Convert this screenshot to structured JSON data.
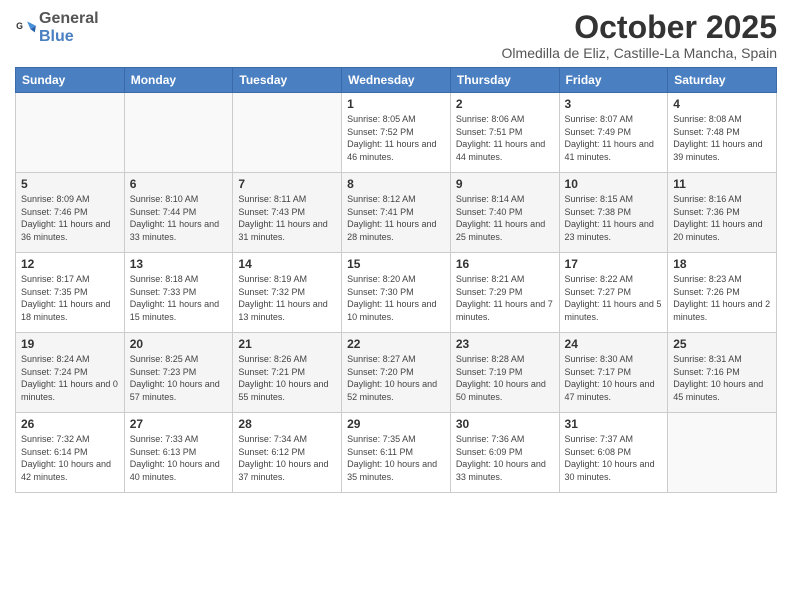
{
  "logo": {
    "general": "General",
    "blue": "Blue"
  },
  "header": {
    "month": "October 2025",
    "subtitle": "Olmedilla de Eliz, Castille-La Mancha, Spain"
  },
  "weekdays": [
    "Sunday",
    "Monday",
    "Tuesday",
    "Wednesday",
    "Thursday",
    "Friday",
    "Saturday"
  ],
  "weeks": [
    [
      {
        "day": "",
        "sunrise": "",
        "sunset": "",
        "daylight": ""
      },
      {
        "day": "",
        "sunrise": "",
        "sunset": "",
        "daylight": ""
      },
      {
        "day": "",
        "sunrise": "",
        "sunset": "",
        "daylight": ""
      },
      {
        "day": "1",
        "sunrise": "Sunrise: 8:05 AM",
        "sunset": "Sunset: 7:52 PM",
        "daylight": "Daylight: 11 hours and 46 minutes."
      },
      {
        "day": "2",
        "sunrise": "Sunrise: 8:06 AM",
        "sunset": "Sunset: 7:51 PM",
        "daylight": "Daylight: 11 hours and 44 minutes."
      },
      {
        "day": "3",
        "sunrise": "Sunrise: 8:07 AM",
        "sunset": "Sunset: 7:49 PM",
        "daylight": "Daylight: 11 hours and 41 minutes."
      },
      {
        "day": "4",
        "sunrise": "Sunrise: 8:08 AM",
        "sunset": "Sunset: 7:48 PM",
        "daylight": "Daylight: 11 hours and 39 minutes."
      }
    ],
    [
      {
        "day": "5",
        "sunrise": "Sunrise: 8:09 AM",
        "sunset": "Sunset: 7:46 PM",
        "daylight": "Daylight: 11 hours and 36 minutes."
      },
      {
        "day": "6",
        "sunrise": "Sunrise: 8:10 AM",
        "sunset": "Sunset: 7:44 PM",
        "daylight": "Daylight: 11 hours and 33 minutes."
      },
      {
        "day": "7",
        "sunrise": "Sunrise: 8:11 AM",
        "sunset": "Sunset: 7:43 PM",
        "daylight": "Daylight: 11 hours and 31 minutes."
      },
      {
        "day": "8",
        "sunrise": "Sunrise: 8:12 AM",
        "sunset": "Sunset: 7:41 PM",
        "daylight": "Daylight: 11 hours and 28 minutes."
      },
      {
        "day": "9",
        "sunrise": "Sunrise: 8:14 AM",
        "sunset": "Sunset: 7:40 PM",
        "daylight": "Daylight: 11 hours and 25 minutes."
      },
      {
        "day": "10",
        "sunrise": "Sunrise: 8:15 AM",
        "sunset": "Sunset: 7:38 PM",
        "daylight": "Daylight: 11 hours and 23 minutes."
      },
      {
        "day": "11",
        "sunrise": "Sunrise: 8:16 AM",
        "sunset": "Sunset: 7:36 PM",
        "daylight": "Daylight: 11 hours and 20 minutes."
      }
    ],
    [
      {
        "day": "12",
        "sunrise": "Sunrise: 8:17 AM",
        "sunset": "Sunset: 7:35 PM",
        "daylight": "Daylight: 11 hours and 18 minutes."
      },
      {
        "day": "13",
        "sunrise": "Sunrise: 8:18 AM",
        "sunset": "Sunset: 7:33 PM",
        "daylight": "Daylight: 11 hours and 15 minutes."
      },
      {
        "day": "14",
        "sunrise": "Sunrise: 8:19 AM",
        "sunset": "Sunset: 7:32 PM",
        "daylight": "Daylight: 11 hours and 13 minutes."
      },
      {
        "day": "15",
        "sunrise": "Sunrise: 8:20 AM",
        "sunset": "Sunset: 7:30 PM",
        "daylight": "Daylight: 11 hours and 10 minutes."
      },
      {
        "day": "16",
        "sunrise": "Sunrise: 8:21 AM",
        "sunset": "Sunset: 7:29 PM",
        "daylight": "Daylight: 11 hours and 7 minutes."
      },
      {
        "day": "17",
        "sunrise": "Sunrise: 8:22 AM",
        "sunset": "Sunset: 7:27 PM",
        "daylight": "Daylight: 11 hours and 5 minutes."
      },
      {
        "day": "18",
        "sunrise": "Sunrise: 8:23 AM",
        "sunset": "Sunset: 7:26 PM",
        "daylight": "Daylight: 11 hours and 2 minutes."
      }
    ],
    [
      {
        "day": "19",
        "sunrise": "Sunrise: 8:24 AM",
        "sunset": "Sunset: 7:24 PM",
        "daylight": "Daylight: 11 hours and 0 minutes."
      },
      {
        "day": "20",
        "sunrise": "Sunrise: 8:25 AM",
        "sunset": "Sunset: 7:23 PM",
        "daylight": "Daylight: 10 hours and 57 minutes."
      },
      {
        "day": "21",
        "sunrise": "Sunrise: 8:26 AM",
        "sunset": "Sunset: 7:21 PM",
        "daylight": "Daylight: 10 hours and 55 minutes."
      },
      {
        "day": "22",
        "sunrise": "Sunrise: 8:27 AM",
        "sunset": "Sunset: 7:20 PM",
        "daylight": "Daylight: 10 hours and 52 minutes."
      },
      {
        "day": "23",
        "sunrise": "Sunrise: 8:28 AM",
        "sunset": "Sunset: 7:19 PM",
        "daylight": "Daylight: 10 hours and 50 minutes."
      },
      {
        "day": "24",
        "sunrise": "Sunrise: 8:30 AM",
        "sunset": "Sunset: 7:17 PM",
        "daylight": "Daylight: 10 hours and 47 minutes."
      },
      {
        "day": "25",
        "sunrise": "Sunrise: 8:31 AM",
        "sunset": "Sunset: 7:16 PM",
        "daylight": "Daylight: 10 hours and 45 minutes."
      }
    ],
    [
      {
        "day": "26",
        "sunrise": "Sunrise: 7:32 AM",
        "sunset": "Sunset: 6:14 PM",
        "daylight": "Daylight: 10 hours and 42 minutes."
      },
      {
        "day": "27",
        "sunrise": "Sunrise: 7:33 AM",
        "sunset": "Sunset: 6:13 PM",
        "daylight": "Daylight: 10 hours and 40 minutes."
      },
      {
        "day": "28",
        "sunrise": "Sunrise: 7:34 AM",
        "sunset": "Sunset: 6:12 PM",
        "daylight": "Daylight: 10 hours and 37 minutes."
      },
      {
        "day": "29",
        "sunrise": "Sunrise: 7:35 AM",
        "sunset": "Sunset: 6:11 PM",
        "daylight": "Daylight: 10 hours and 35 minutes."
      },
      {
        "day": "30",
        "sunrise": "Sunrise: 7:36 AM",
        "sunset": "Sunset: 6:09 PM",
        "daylight": "Daylight: 10 hours and 33 minutes."
      },
      {
        "day": "31",
        "sunrise": "Sunrise: 7:37 AM",
        "sunset": "Sunset: 6:08 PM",
        "daylight": "Daylight: 10 hours and 30 minutes."
      },
      {
        "day": "",
        "sunrise": "",
        "sunset": "",
        "daylight": ""
      }
    ]
  ]
}
